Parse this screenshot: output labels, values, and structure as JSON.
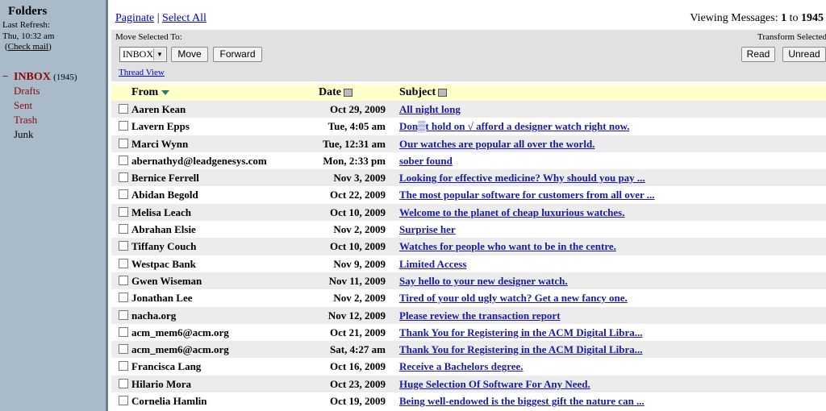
{
  "sidebar": {
    "title": "Folders",
    "last_refresh_label": "Last Refresh:",
    "last_refresh_time": "Thu, 10:32 am",
    "check_mail": "Check mail",
    "folders": [
      {
        "name": "INBOX",
        "count": "(1945)",
        "collapse": "−"
      },
      {
        "name": "Drafts"
      },
      {
        "name": "Sent"
      },
      {
        "name": "Trash"
      },
      {
        "name": "Junk"
      }
    ]
  },
  "topbar": {
    "paginate": "Paginate",
    "separator": "|",
    "select_all": "Select All",
    "viewing_prefix": "Viewing Messages:",
    "viewing_from": "1",
    "viewing_to_word": "to",
    "viewing_to": "1945"
  },
  "toolbar": {
    "move_selected_label": "Move Selected To:",
    "folder_select_value": "INBOX",
    "move_button": "Move",
    "forward_button": "Forward",
    "thread_view": "Thread View",
    "transform_label": "Transform Selected Messages:",
    "read_button": "Read",
    "unread_button": "Unread"
  },
  "columns": {
    "from": "From",
    "date": "Date",
    "subject": "Subject"
  },
  "messages": [
    {
      "from": "Aaren Kean",
      "date": "Oct 29, 2009",
      "subject": "All night long"
    },
    {
      "from": "Lavern Epps",
      "date": "Tue, 4:05 am",
      "subject": "Don▒t hold on √ afford a designer watch right now."
    },
    {
      "from": "Marci Wynn",
      "date": "Tue, 12:31 am",
      "subject": "Our watches are popular all over the world."
    },
    {
      "from": "abernathyd@leadgenesys.com",
      "date": "Mon, 2:33 pm",
      "subject": "sober found"
    },
    {
      "from": "Bernice Ferrell",
      "date": "Nov 3, 2009",
      "subject": "Looking for effective medicine? Why should you pay ..."
    },
    {
      "from": "Abidan Begold",
      "date": "Oct 22, 2009",
      "subject": "The most popular software for customers from all over ..."
    },
    {
      "from": "Melisa Leach",
      "date": "Oct 10, 2009",
      "subject": "Welcome to the planet of cheap luxurious watches."
    },
    {
      "from": "Abrahan Elsie",
      "date": "Nov 2, 2009",
      "subject": "Surprise her"
    },
    {
      "from": "Tiffany Couch",
      "date": "Oct 10, 2009",
      "subject": "Watches for people who want to be in the centre."
    },
    {
      "from": "Westpac Bank",
      "date": "Nov 9, 2009",
      "subject": "Limited Access"
    },
    {
      "from": "Gwen Wiseman",
      "date": "Nov 11, 2009",
      "subject": "Say hello to your new designer watch."
    },
    {
      "from": "Jonathan Lee",
      "date": "Nov 2, 2009",
      "subject": "Tired of your old ugly watch? Get a new fancy one."
    },
    {
      "from": "nacha.org",
      "date": "Nov 12, 2009",
      "subject": "Please review the transaction report"
    },
    {
      "from": "acm_mem6@acm.org",
      "date": "Oct 21, 2009",
      "subject": "Thank You for Registering in the ACM Digital Libra..."
    },
    {
      "from": "acm_mem6@acm.org",
      "date": "Sat, 4:27 am",
      "subject": "Thank You for Registering in the ACM Digital Libra..."
    },
    {
      "from": "Francisca Lang",
      "date": "Oct 16, 2009",
      "subject": "Receive a Bachelors degree."
    },
    {
      "from": "Hilario Mora",
      "date": "Oct 23, 2009",
      "subject": "Huge Selection Of Software For Any Need."
    },
    {
      "from": "Cornelia Hamlin",
      "date": "Oct 19, 2009",
      "subject": "Being well-endowed is the biggest gift the nature can ..."
    }
  ]
}
